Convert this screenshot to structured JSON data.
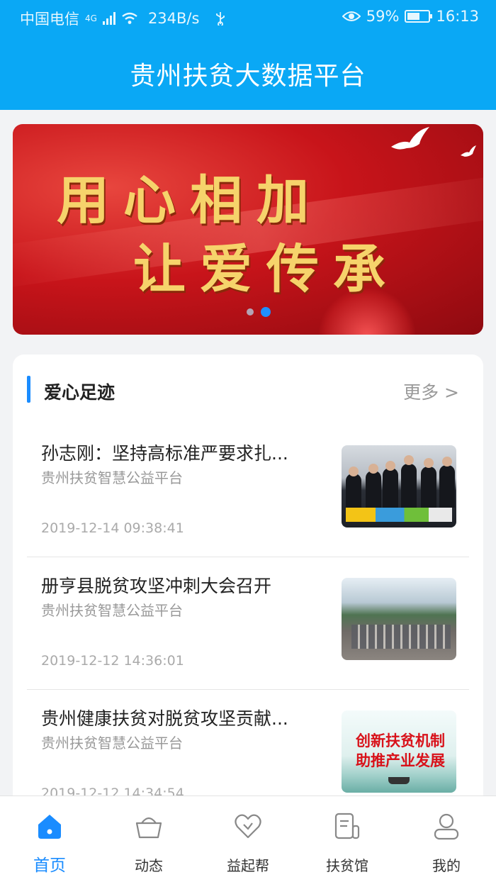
{
  "status_bar": {
    "carrier": "中国电信",
    "network": "4G",
    "speed": "234B/s",
    "battery": "59%",
    "battery_level": 0.59,
    "time": "16:13"
  },
  "header": {
    "title": "贵州扶贫大数据平台"
  },
  "banner": {
    "line1": "用心相加",
    "line2": "让爱传承",
    "slide_count": 2,
    "active_slide": 2
  },
  "section": {
    "title": "爱心足迹",
    "more_label": "更多 >"
  },
  "news": [
    {
      "title": "孙志刚：坚持高标准严要求扎...",
      "source": "贵州扶贫智慧公益平台",
      "date": "2019-12-14 09:38:41"
    },
    {
      "title": "册亨县脱贫攻坚冲刺大会召开",
      "source": "贵州扶贫智慧公益平台",
      "date": "2019-12-12 14:36:01"
    },
    {
      "title": "贵州健康扶贫对脱贫攻坚贡献...",
      "source": "贵州扶贫智慧公益平台",
      "date": "2019-12-12 14:34:54",
      "thumb_text": [
        "创新扶贫机制",
        "助推产业发展"
      ]
    }
  ],
  "bottom_nav": [
    {
      "label": "首页",
      "icon": "home-icon",
      "active": true
    },
    {
      "label": "动态",
      "icon": "basket-icon",
      "active": false
    },
    {
      "label": "益起帮",
      "icon": "heart-icon",
      "active": false
    },
    {
      "label": "扶贫馆",
      "icon": "document-icon",
      "active": false
    },
    {
      "label": "我的",
      "icon": "user-icon",
      "active": false
    }
  ],
  "colors": {
    "primary": "#0aa8f5",
    "accent": "#1a8cff",
    "banner_red": "#c8141a",
    "banner_gold": "#f6d36b"
  }
}
